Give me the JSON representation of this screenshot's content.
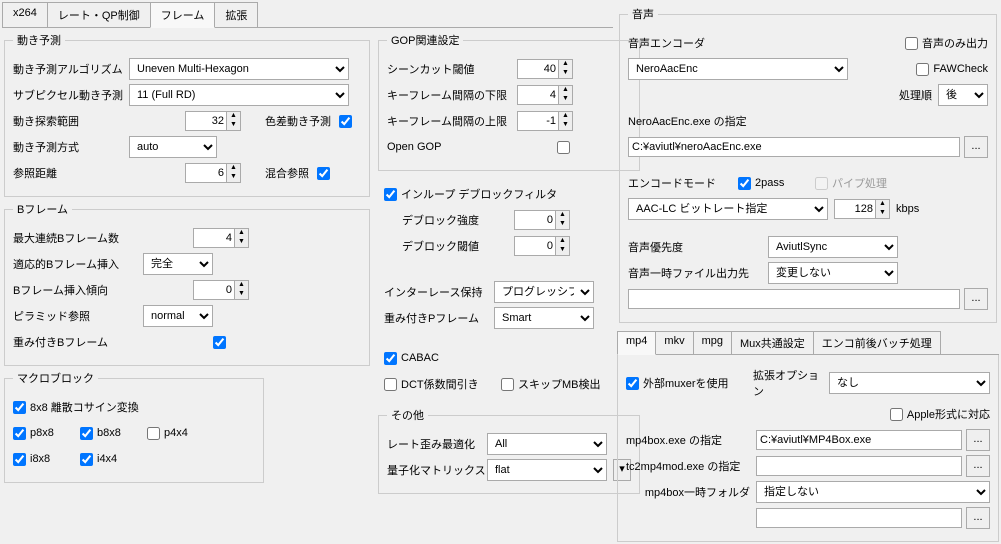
{
  "left_tabs": [
    "x264",
    "レート・QP制御",
    "フレーム",
    "拡張"
  ],
  "left_active": 2,
  "motion": {
    "legend": "動き予測",
    "algo_label": "動き予測アルゴリズム",
    "algo_value": "Uneven Multi-Hexagon",
    "subpixel_label": "サブピクセル動き予測",
    "subpixel_value": "11 (Full RD)",
    "range_label": "動き探索範囲",
    "range_value": "32",
    "chroma_label": "色差動き予測",
    "method_label": "動き予測方式",
    "method_value": "auto",
    "ref_label": "参照距離",
    "ref_value": "6",
    "mixed_label": "混合参照"
  },
  "gop": {
    "legend": "GOP関連設定",
    "scenecut_label": "シーンカット閾値",
    "scenecut_value": "40",
    "keymin_label": "キーフレーム間隔の下限",
    "keymin_value": "4",
    "keymax_label": "キーフレーム間隔の上限",
    "keymax_value": "-1",
    "opengop_label": "Open GOP"
  },
  "deblock": {
    "inloop_label": "インループ デブロックフィルタ",
    "strength_label": "デブロック強度",
    "strength_value": "0",
    "thresh_label": "デブロック閾値",
    "thresh_value": "0"
  },
  "bframe": {
    "legend": "Bフレーム",
    "max_label": "最大連続Bフレーム数",
    "max_value": "4",
    "adapt_label": "適応的Bフレーム挿入",
    "adapt_value": "完全",
    "bias_label": "Bフレーム挿入傾向",
    "bias_value": "0",
    "pyramid_label": "ピラミッド参照",
    "pyramid_value": "normal",
    "weighted_label": "重み付きBフレーム"
  },
  "interlace": {
    "keep_label": "インターレース保持",
    "keep_value": "プログレッシブ",
    "weightp_label": "重み付きPフレーム",
    "weightp_value": "Smart",
    "cabac_label": "CABAC",
    "dct_label": "DCT係数間引き",
    "skip_label": "スキップMB検出"
  },
  "macro": {
    "legend": "マクロブロック",
    "dct8_label": "8x8 離散コサイン変換",
    "p8x8": "p8x8",
    "b8x8": "b8x8",
    "p4x4": "p4x4",
    "i8x8": "i8x8",
    "i4x4": "i4x4"
  },
  "other": {
    "legend": "その他",
    "trellis_label": "レート歪み最適化",
    "trellis_value": "All",
    "cqm_label": "量子化マトリックス",
    "cqm_value": "flat"
  },
  "audio": {
    "legend": "音声",
    "only_label": "音声のみ出力",
    "faw_label": "FAWCheck",
    "encoder_label": "音声エンコーダ",
    "encoder_value": "NeroAacEnc",
    "order_label": "処理順",
    "order_value": "後",
    "exe_label": "NeroAacEnc.exe の指定",
    "exe_value": "C:¥aviutl¥neroAacEnc.exe",
    "mode_label": "エンコードモード",
    "twopass_label": "2pass",
    "pipe_label": "パイプ処理",
    "mode_value": "AAC-LC ビットレート指定",
    "bitrate_value": "128",
    "kbps": "kbps",
    "priority_label": "音声優先度",
    "priority_value": "AviutlSync",
    "tmp_label": "音声一時ファイル出力先",
    "tmp_value": "変更しない",
    "tmp_path": ""
  },
  "mux_tabs": [
    "mp4",
    "mkv",
    "mpg",
    "Mux共通設定",
    "エンコ前後バッチ処理"
  ],
  "mux_active": 0,
  "mux": {
    "ext_label": "外部muxerを使用",
    "opt_label": "拡張オプション",
    "opt_value": "なし",
    "apple_label": "Apple形式に対応",
    "mp4box_label": "mp4box.exe の指定",
    "mp4box_value": "C:¥aviutl¥MP4Box.exe",
    "tc2mp4_label": "tc2mp4mod.exe の指定",
    "tc2mp4_value": "",
    "tmp_label": "mp4box一時フォルダ",
    "tmp_value": "指定しない",
    "tmp_path": ""
  }
}
